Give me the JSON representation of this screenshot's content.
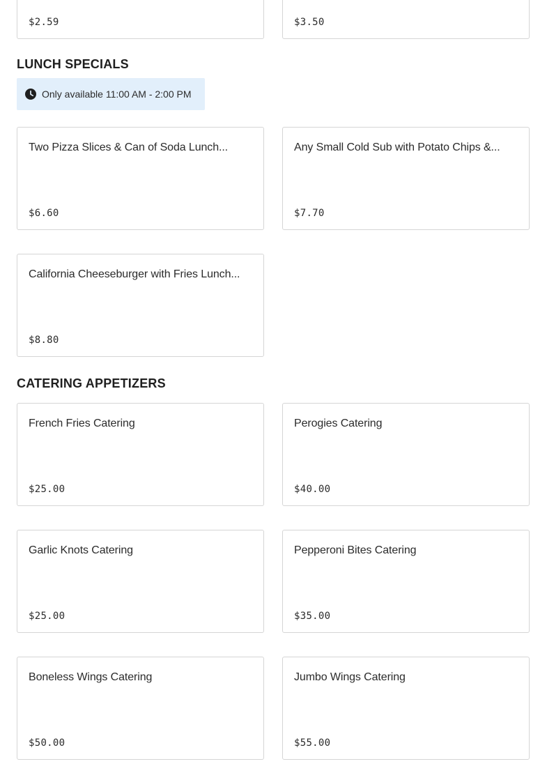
{
  "top_partial_items": [
    {
      "price": "$2.59"
    },
    {
      "price": "$3.50"
    }
  ],
  "sections": {
    "lunch_specials": {
      "title": "LUNCH SPECIALS",
      "availability": "Only available 11:00 AM - 2:00 PM",
      "icon": "clock-icon",
      "items": [
        {
          "name": "Two Pizza Slices & Can of Soda Lunch...",
          "price": "$6.60"
        },
        {
          "name": "Any Small Cold Sub with Potato Chips &...",
          "price": "$7.70"
        },
        {
          "name": "California Cheeseburger with Fries Lunch...",
          "price": "$8.80"
        }
      ]
    },
    "catering_appetizers": {
      "title": "CATERING APPETIZERS",
      "items": [
        {
          "name": "French Fries Catering",
          "price": "$25.00"
        },
        {
          "name": "Perogies Catering",
          "price": "$40.00"
        },
        {
          "name": "Garlic Knots Catering",
          "price": "$25.00"
        },
        {
          "name": "Pepperoni Bites Catering",
          "price": "$35.00"
        },
        {
          "name": "Boneless Wings Catering",
          "price": "$50.00"
        },
        {
          "name": "Jumbo Wings Catering",
          "price": "$55.00"
        }
      ]
    }
  }
}
